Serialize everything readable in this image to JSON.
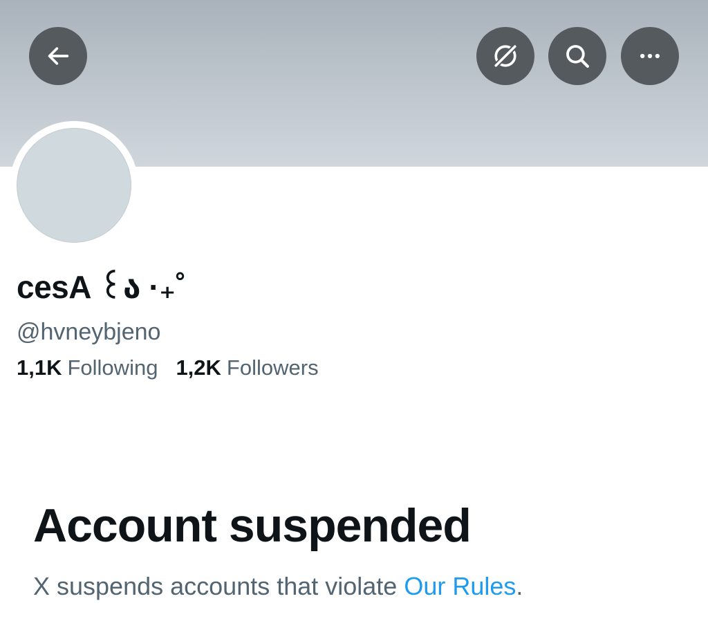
{
  "header": {
    "icons": [
      "back-arrow-icon",
      "grok-icon",
      "search-icon",
      "more-icon"
    ],
    "button_color": "#555a5e"
  },
  "profile": {
    "display_name": "cesA ꒰⁠ა ·₊˚",
    "handle": "@hvneybjeno",
    "following_count": "1,1K",
    "following_label": "Following",
    "followers_count": "1,2K",
    "followers_label": "Followers"
  },
  "notice": {
    "title": "Account suspended",
    "text_before": "X suspends accounts that violate ",
    "link_label": "Our Rules",
    "text_after": "."
  },
  "colors": {
    "text_primary": "#0f1419",
    "text_secondary": "#536471",
    "link": "#1d9bf0",
    "avatar_placeholder": "#cfd9de"
  }
}
